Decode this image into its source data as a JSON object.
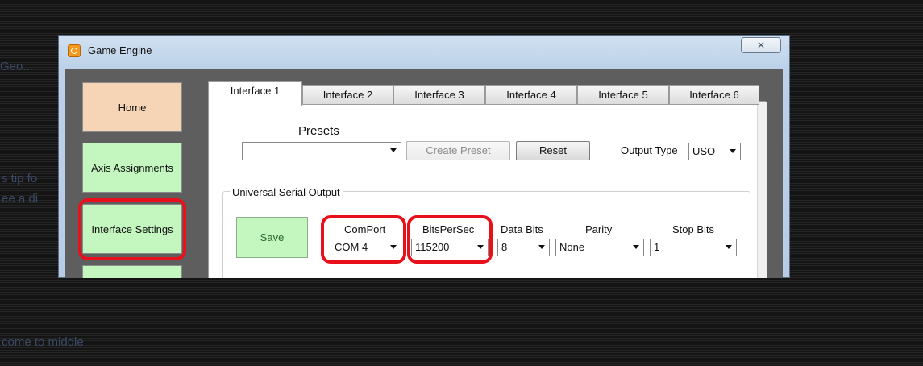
{
  "window": {
    "title": "Game Engine",
    "close_glyph": "✕"
  },
  "nav": {
    "home": "Home",
    "axis": "Axis Assignments",
    "interface": "Interface Settings"
  },
  "tabs": [
    "Interface 1",
    "Interface 2",
    "Interface 3",
    "Interface 4",
    "Interface 5",
    "Interface 6"
  ],
  "active_tab": "Interface 1",
  "presets": {
    "heading": "Presets",
    "selected": "",
    "create_label": "Create Preset",
    "reset_label": "Reset"
  },
  "output_type": {
    "label": "Output Type",
    "value": "USO"
  },
  "uso": {
    "group_title": "Universal Serial Output",
    "save_label": "Save",
    "com_port": {
      "label": "ComPort",
      "value": "COM 4"
    },
    "bits_per_sec": {
      "label": "BitsPerSec",
      "value": "115200"
    },
    "data_bits": {
      "label": "Data Bits",
      "value": "8"
    },
    "parity": {
      "label": "Parity",
      "value": "None"
    },
    "stop_bits": {
      "label": "Stop Bits",
      "value": "1"
    }
  },
  "highlight_color": "#e8101a",
  "icons": [
    "app-power-icon",
    "close-icon",
    "dropdown-arrow-icon"
  ]
}
